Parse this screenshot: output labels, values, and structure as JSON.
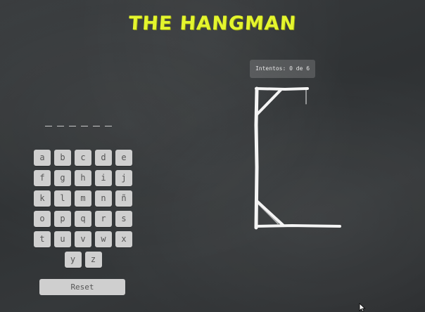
{
  "game": {
    "title": "THE HANGMAN",
    "attempts_label": "Intentos: 0 de 6",
    "attempts_used": 0,
    "attempts_max": 6,
    "word_slots": [
      "",
      "",
      "",
      "",
      "",
      ""
    ],
    "reset_label": "Reset"
  },
  "keyboard": {
    "rows": [
      [
        "a",
        "b",
        "c",
        "d",
        "e"
      ],
      [
        "f",
        "g",
        "h",
        "i",
        "j"
      ],
      [
        "k",
        "l",
        "m",
        "n",
        "ñ"
      ],
      [
        "o",
        "p",
        "q",
        "r",
        "s"
      ],
      [
        "t",
        "u",
        "v",
        "w",
        "x"
      ],
      [
        "y",
        "z"
      ]
    ]
  },
  "colors": {
    "title": "#e4f52e",
    "key_bg": "#cfcfcf",
    "chalk": "#f4f4f4"
  },
  "icons": {
    "cursor": "mouse-pointer-icon"
  }
}
